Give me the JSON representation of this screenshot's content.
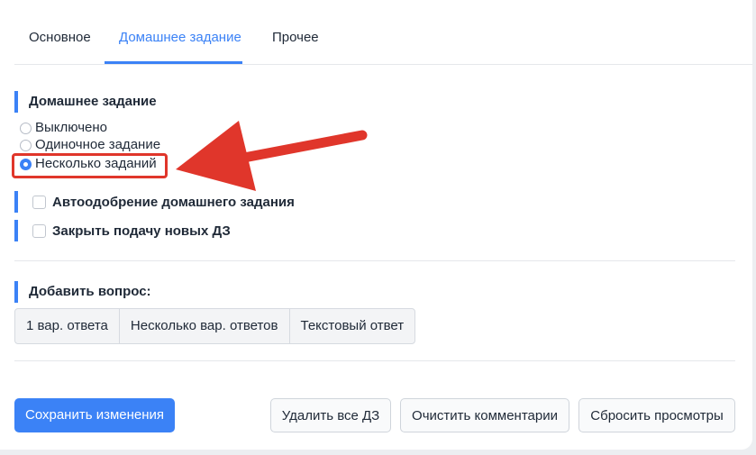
{
  "tabs": [
    {
      "label": "Основное"
    },
    {
      "label": "Домашнее задание"
    },
    {
      "label": "Прочее"
    }
  ],
  "homework": {
    "title": "Домашнее задание",
    "options": [
      {
        "label": "Выключено"
      },
      {
        "label": "Одиночное задание"
      },
      {
        "label": "Несколько заданий"
      }
    ],
    "selected_option": "Несколько заданий"
  },
  "checkboxes": [
    {
      "label": "Автоодобрение домашнего задания",
      "checked": false
    },
    {
      "label": "Закрыть подачу новых ДЗ",
      "checked": false
    }
  ],
  "add_question": {
    "title": "Добавить вопрос:",
    "types": [
      {
        "label": "1 вар. ответа"
      },
      {
        "label": "Несколько вар. ответов"
      },
      {
        "label": "Текстовый ответ"
      }
    ]
  },
  "actions": {
    "save": "Сохранить изменения",
    "delete_all": "Удалить все ДЗ",
    "clear_comments": "Очистить комментарии",
    "reset_views": "Сбросить просмотры"
  },
  "colors": {
    "accent": "#3b82f6",
    "annotation": "#e0362b"
  }
}
